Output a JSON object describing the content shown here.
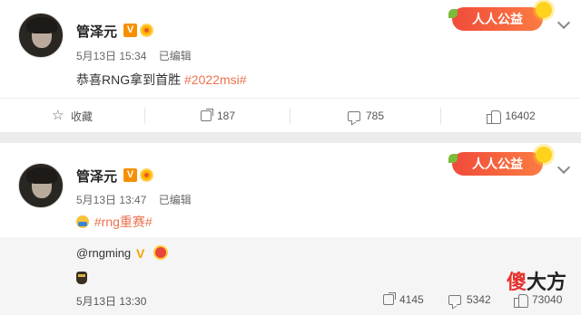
{
  "posts": [
    {
      "author": "管泽元",
      "verified_mark": "V",
      "date": "5月13日 15:34",
      "edited": "已编辑",
      "text": "恭喜RNG拿到首胜",
      "hashtag": "#2022msi#",
      "charity_badge": "人人公益",
      "actions": {
        "favorite_label": "收藏",
        "reposts": "187",
        "comments": "785",
        "likes": "16402"
      }
    },
    {
      "author": "管泽元",
      "verified_mark": "V",
      "date": "5月13日 13:47",
      "edited": "已编辑",
      "hashtag": "#rng重赛#",
      "charity_badge": "人人公益",
      "retweet": {
        "author": "@rngming",
        "verified_mark": "V",
        "date": "5月13日 13:30",
        "reposts": "4145",
        "comments": "5342",
        "likes": "73040"
      }
    }
  ],
  "watermark": {
    "first": "傻",
    "rest": "大方"
  },
  "colors": {
    "accent": "#eb7350",
    "verified": "#f79000",
    "badge_red": "#f04b3b"
  }
}
